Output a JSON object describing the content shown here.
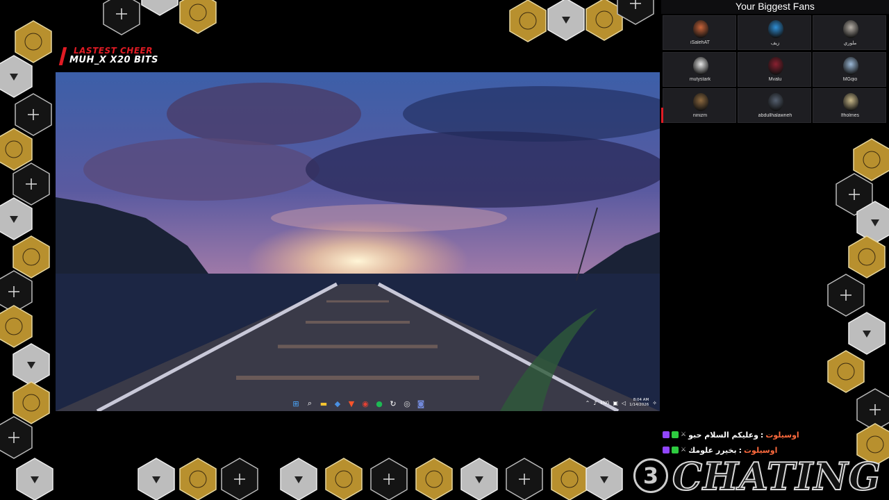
{
  "cheer": {
    "heading": "LASTEST CHEER",
    "detail": "MUH_X X20 BITS"
  },
  "fans": {
    "title": "Your Biggest Fans",
    "items": [
      {
        "name": "iSalehAT",
        "color": "#c8643a"
      },
      {
        "name": "زيف",
        "color": "#2f8fd6"
      },
      {
        "name": "ملوري",
        "color": "#b7b0a8"
      },
      {
        "name": "mutystark",
        "color": "#e6e6e6"
      },
      {
        "name": "Mvalu",
        "color": "#8a2030"
      },
      {
        "name": "MGqio",
        "color": "#9bb8d6"
      },
      {
        "name": "ninizm",
        "color": "#8e6a40"
      },
      {
        "name": "abdullhalawneh",
        "color": "#556070"
      },
      {
        "name": "lfholmes",
        "color": "#c9b98a"
      }
    ]
  },
  "chat": [
    {
      "user": "اوسيلوت",
      "message": "وعليكم السلام حبو"
    },
    {
      "user": "اوسيلوت",
      "message": "بخيرر علومك"
    }
  ],
  "taskbar": {
    "apps": [
      "windows-start-icon",
      "search-icon",
      "file-explorer-icon",
      "store-icon",
      "brave-icon",
      "chrome-icon",
      "spotify-icon",
      "refresh-icon",
      "obs-icon",
      "discord-icon"
    ],
    "lang": "ENG",
    "time": "8:04 AM",
    "date": "1/14/2026"
  },
  "brand": {
    "number": "3",
    "word": "CHATING"
  },
  "colors": {
    "accent_red": "#e01b24",
    "fan_card": "#1e1e22",
    "hex_gold": "#c9a23a",
    "hex_grey": "#9a9a9a"
  }
}
